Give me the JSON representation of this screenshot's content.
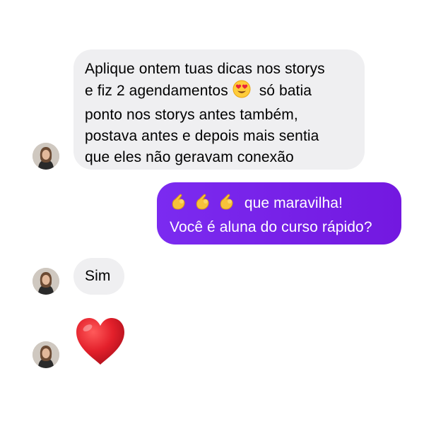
{
  "conversation": {
    "messages": [
      {
        "sender": "contact",
        "lines": [
          "Aplique ontem tuas dicas nos storys",
          "e fiz 2 agendamentos",
          "só batia",
          "ponto nos storys antes também,",
          "postava antes e depois mais sentia",
          "que eles não geravam conexão"
        ],
        "emoji": "heart-eyes-emoji"
      },
      {
        "sender": "me",
        "lines": [
          "que maravilha!",
          "Você é aluna do curso rápido?"
        ],
        "emoji": "pinching-hand-emoji"
      },
      {
        "sender": "contact",
        "lines": [
          "Sim"
        ]
      },
      {
        "sender": "contact",
        "emoji": "red-heart-emoji"
      }
    ]
  },
  "colors": {
    "incoming_bubble": "#efeff1",
    "outgoing_bubble": "#7a1fe6",
    "outgoing_text": "#ffffff",
    "heart": "#e3202b"
  }
}
